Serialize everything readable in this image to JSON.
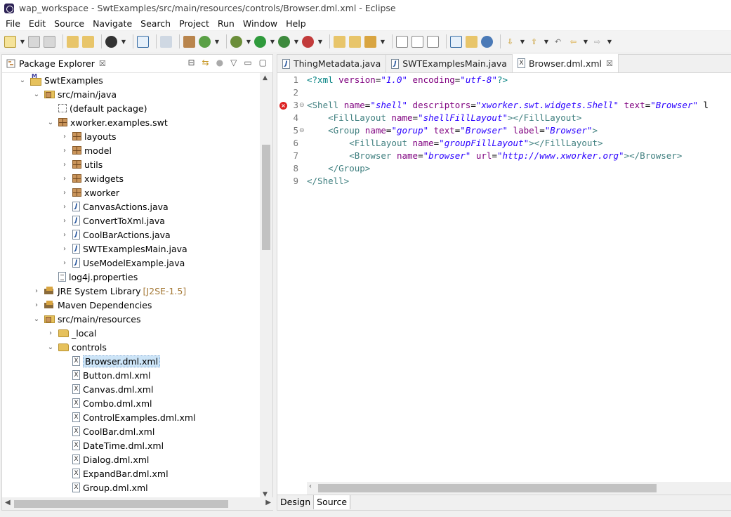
{
  "window": {
    "title": "wap_workspace - SwtExamples/src/main/resources/controls/Browser.dml.xml - Eclipse"
  },
  "menu": [
    "File",
    "Edit",
    "Source",
    "Navigate",
    "Search",
    "Project",
    "Run",
    "Window",
    "Help"
  ],
  "package_explorer": {
    "tab_label": "Package Explorer",
    "tab_close": "☒",
    "tree": [
      {
        "label": "SwtExamples",
        "icon": "project-icon",
        "twisty": "⌄"
      },
      {
        "label": "src/main/java",
        "icon": "source-folder-icon",
        "twisty": "⌄"
      },
      {
        "label": "(default package)",
        "icon": "empty-package-icon",
        "twisty": ""
      },
      {
        "label": "xworker.examples.swt",
        "icon": "package-icon",
        "twisty": "⌄"
      },
      {
        "label": "layouts",
        "icon": "package-icon",
        "twisty": "›"
      },
      {
        "label": "model",
        "icon": "package-icon",
        "twisty": "›"
      },
      {
        "label": "utils",
        "icon": "package-icon",
        "twisty": "›"
      },
      {
        "label": "xwidgets",
        "icon": "package-icon",
        "twisty": "›"
      },
      {
        "label": "xworker",
        "icon": "package-icon",
        "twisty": "›"
      },
      {
        "label": "CanvasActions.java",
        "icon": "java-file-icon",
        "twisty": "›"
      },
      {
        "label": "ConvertToXml.java",
        "icon": "java-file-icon",
        "twisty": "›"
      },
      {
        "label": "CoolBarActions.java",
        "icon": "java-file-icon",
        "twisty": "›"
      },
      {
        "label": "SWTExamplesMain.java",
        "icon": "java-file-icon",
        "twisty": "›"
      },
      {
        "label": "UseModelExample.java",
        "icon": "java-file-icon",
        "twisty": "›"
      },
      {
        "label": "log4j.properties",
        "icon": "properties-file-icon",
        "twisty": ""
      },
      {
        "label": "JRE System Library",
        "icon": "library-icon",
        "twisty": "›",
        "decoration": "[J2SE-1.5]"
      },
      {
        "label": "Maven Dependencies",
        "icon": "library-icon",
        "twisty": "›"
      },
      {
        "label": "src/main/resources",
        "icon": "source-folder-icon",
        "twisty": "⌄"
      },
      {
        "label": "_local",
        "icon": "folder-icon",
        "twisty": "›"
      },
      {
        "label": "controls",
        "icon": "folder-icon",
        "twisty": "⌄"
      },
      {
        "label": "Browser.dml.xml",
        "icon": "xml-file-icon",
        "twisty": "",
        "selected": true
      },
      {
        "label": "Button.dml.xml",
        "icon": "xml-file-icon",
        "twisty": ""
      },
      {
        "label": "Canvas.dml.xml",
        "icon": "xml-file-icon",
        "twisty": ""
      },
      {
        "label": "Combo.dml.xml",
        "icon": "xml-file-icon",
        "twisty": ""
      },
      {
        "label": "ControlExamples.dml.xml",
        "icon": "xml-file-icon",
        "twisty": ""
      },
      {
        "label": "CoolBar.dml.xml",
        "icon": "xml-file-icon",
        "twisty": ""
      },
      {
        "label": "DateTime.dml.xml",
        "icon": "xml-file-icon",
        "twisty": ""
      },
      {
        "label": "Dialog.dml.xml",
        "icon": "xml-file-icon",
        "twisty": ""
      },
      {
        "label": "ExpandBar.dml.xml",
        "icon": "xml-file-icon",
        "twisty": ""
      },
      {
        "label": "Group.dml.xml",
        "icon": "xml-file-icon",
        "twisty": ""
      }
    ]
  },
  "editor": {
    "tabs": [
      {
        "label": "ThingMetadata.java",
        "icon": "java-file-icon",
        "active": false
      },
      {
        "label": "SWTExamplesMain.java",
        "icon": "java-file-icon",
        "active": false
      },
      {
        "label": "Browser.dml.xml",
        "icon": "xml-file-icon",
        "active": true,
        "close": "☒"
      }
    ],
    "lines": [
      {
        "num": "1",
        "tokens": [
          [
            "pi",
            "<?xml "
          ],
          [
            "attr",
            "version"
          ],
          [
            "plain",
            "="
          ],
          [
            "val",
            "\"1.0\""
          ],
          [
            "plain",
            " "
          ],
          [
            "attr",
            "encoding"
          ],
          [
            "plain",
            "="
          ],
          [
            "val",
            "\"utf-8\""
          ],
          [
            "pi",
            "?>"
          ]
        ]
      },
      {
        "num": "2",
        "tokens": []
      },
      {
        "num": "3",
        "error": true,
        "fold": "⊖",
        "tokens": [
          [
            "tag",
            "<Shell "
          ],
          [
            "attr",
            "name"
          ],
          [
            "plain",
            "="
          ],
          [
            "val",
            "\"shell\""
          ],
          [
            "plain",
            " "
          ],
          [
            "attr",
            "descriptors"
          ],
          [
            "plain",
            "="
          ],
          [
            "val",
            "\"xworker.swt.widgets.Shell\""
          ],
          [
            "plain",
            " "
          ],
          [
            "attr",
            "text"
          ],
          [
            "plain",
            "="
          ],
          [
            "val",
            "\"Browser\""
          ],
          [
            "plain",
            " l"
          ]
        ]
      },
      {
        "num": "4",
        "tokens": [
          [
            "plain",
            "    "
          ],
          [
            "tag",
            "<FillLayout "
          ],
          [
            "attr",
            "name"
          ],
          [
            "plain",
            "="
          ],
          [
            "val",
            "\"shellFillLayout\""
          ],
          [
            "tag",
            "></FillLayout>"
          ]
        ]
      },
      {
        "num": "5",
        "fold": "⊖",
        "tokens": [
          [
            "plain",
            "    "
          ],
          [
            "tag",
            "<Group "
          ],
          [
            "attr",
            "name"
          ],
          [
            "plain",
            "="
          ],
          [
            "val",
            "\"gorup\""
          ],
          [
            "plain",
            " "
          ],
          [
            "attr",
            "text"
          ],
          [
            "plain",
            "="
          ],
          [
            "val",
            "\"Browser\""
          ],
          [
            "plain",
            " "
          ],
          [
            "attr",
            "label"
          ],
          [
            "plain",
            "="
          ],
          [
            "val",
            "\"Browser\""
          ],
          [
            "tag",
            ">"
          ]
        ]
      },
      {
        "num": "6",
        "tokens": [
          [
            "plain",
            "        "
          ],
          [
            "tag",
            "<FillLayout "
          ],
          [
            "attr",
            "name"
          ],
          [
            "plain",
            "="
          ],
          [
            "val",
            "\"groupFillLayout\""
          ],
          [
            "tag",
            "></FillLayout>"
          ]
        ]
      },
      {
        "num": "7",
        "tokens": [
          [
            "plain",
            "        "
          ],
          [
            "tag",
            "<Browser "
          ],
          [
            "attr",
            "name"
          ],
          [
            "plain",
            "="
          ],
          [
            "val",
            "\"browser\""
          ],
          [
            "plain",
            " "
          ],
          [
            "attr",
            "url"
          ],
          [
            "plain",
            "="
          ],
          [
            "val",
            "\"http://www.xworker.org\""
          ],
          [
            "tag",
            "></Browser>"
          ]
        ]
      },
      {
        "num": "8",
        "tokens": [
          [
            "plain",
            "    "
          ],
          [
            "tag",
            "</Group>"
          ]
        ]
      },
      {
        "num": "9",
        "tokens": [
          [
            "tag",
            "</Shell>"
          ]
        ]
      }
    ],
    "bottom_tabs": [
      {
        "label": "Design",
        "active": false
      },
      {
        "label": "Source",
        "active": true
      }
    ]
  },
  "colors": {
    "tag": "#3f7f7f",
    "attribute": "#7f007f",
    "value": "#2a00ff",
    "selection": "#cce4f7"
  }
}
